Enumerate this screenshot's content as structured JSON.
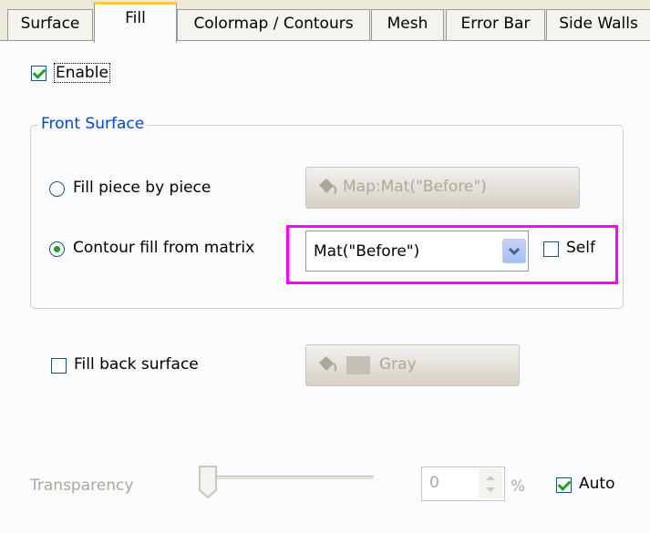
{
  "tabs": [
    {
      "label": "Surface"
    },
    {
      "label": "Fill"
    },
    {
      "label": "Colormap / Contours"
    },
    {
      "label": "Mesh"
    },
    {
      "label": "Error Bar"
    },
    {
      "label": "Side Walls"
    }
  ],
  "enable": {
    "label": "Enable",
    "checked": true
  },
  "front_surface": {
    "title": "Front Surface",
    "fill_piece": {
      "label": "Fill piece by piece",
      "selected": false,
      "button_label": "Map:Mat(\"Before\")"
    },
    "contour_fill": {
      "label": "Contour fill from matrix",
      "selected": true,
      "combo_value": "Mat(\"Before\")",
      "self_label": "Self",
      "self_checked": false
    }
  },
  "back_surface": {
    "label": "Fill back surface",
    "checked": false,
    "button_label": "Gray"
  },
  "transparency": {
    "label": "Transparency",
    "value": "0",
    "unit": "%",
    "auto_label": "Auto",
    "auto_checked": true
  },
  "colors": {
    "accent_tab": "#ffc83c",
    "highlight": "#ff00ff",
    "group_title": "#0046d5"
  }
}
